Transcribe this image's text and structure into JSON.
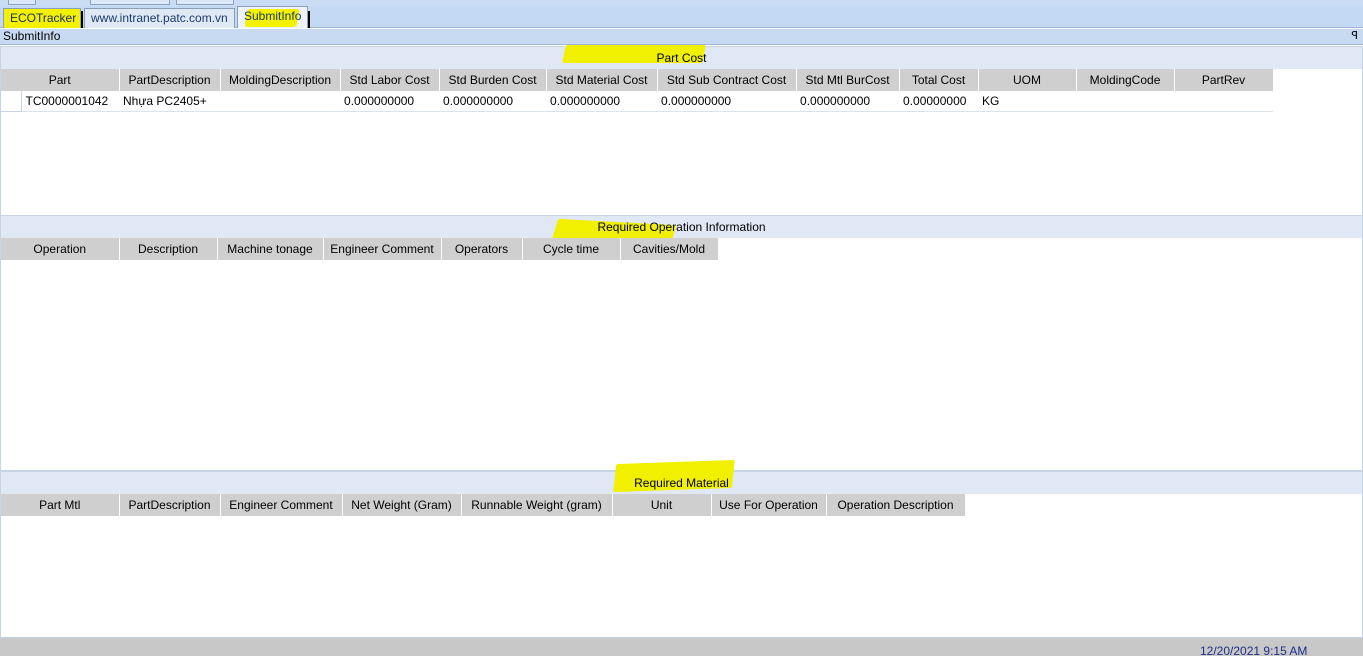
{
  "tabs": [
    {
      "label": "ECOTracker"
    },
    {
      "label": "www.intranet.patc.com.vn"
    },
    {
      "label": "SubmitInfo"
    }
  ],
  "panel": {
    "title": "SubmitInfo",
    "pin_glyph": "ꟼ"
  },
  "part_cost": {
    "title": "Part Cost",
    "columns": [
      "Part",
      "PartDescription",
      "MoldingDescription",
      "Std Labor Cost",
      "Std Burden Cost",
      "Std Material Cost",
      "Std Sub Contract Cost",
      "Std Mtl BurCost",
      "Total Cost",
      "UOM",
      "MoldingCode",
      "PartRev"
    ],
    "rows": [
      [
        "TC0000001042",
        "Nhựa PC2405+",
        "",
        "0.000000000",
        "0.000000000",
        "0.000000000",
        "0.000000000",
        "0.000000000",
        "0.00000000",
        "KG",
        "",
        ""
      ]
    ]
  },
  "operation_info": {
    "title": "Required Operation Information",
    "columns": [
      "Operation",
      "Description",
      "Machine tonage",
      "Engineer Comment",
      "Operators",
      "Cycle time",
      "Cavities/Mold"
    ]
  },
  "material": {
    "title": "Required Material",
    "columns": [
      "Part Mtl",
      "PartDescription",
      "Engineer Comment",
      "Net Weight (Gram)",
      "Runnable Weight (gram)",
      "Unit",
      "Use For Operation",
      "Operation Description"
    ]
  },
  "status": {
    "datetime": "12/20/2021  9:15 AM"
  },
  "colors": {
    "highlight": "#f0f000",
    "tab_bg": "#c4d9f3",
    "header_gray": "#cfcfcf",
    "status_text": "#1e2f86"
  }
}
